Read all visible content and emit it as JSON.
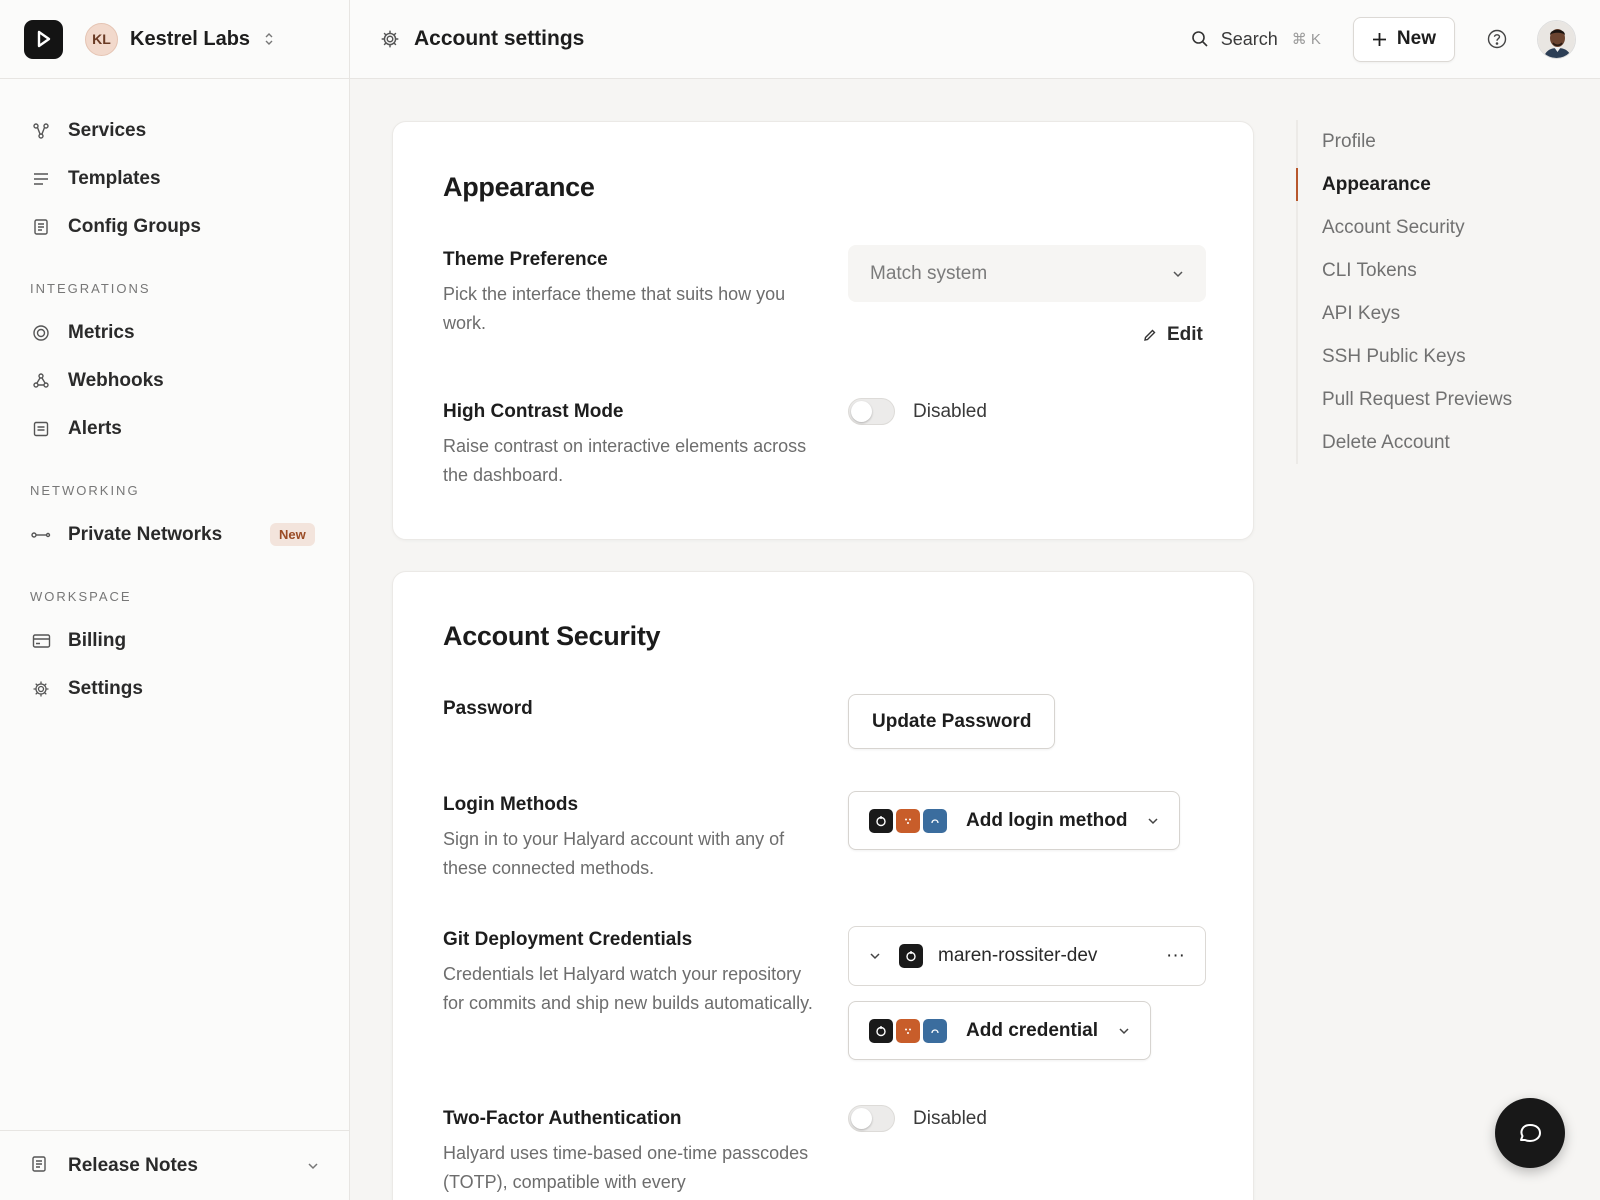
{
  "team": {
    "initials": "KL",
    "name": "Kestrel Labs"
  },
  "header": {
    "title": "Account settings",
    "search_label": "Search",
    "search_shortcut": "⌘ K",
    "new_label": "New"
  },
  "sidebar": {
    "main": [
      {
        "label": "Services",
        "icon": "services-icon"
      },
      {
        "label": "Templates",
        "icon": "templates-icon"
      },
      {
        "label": "Config Groups",
        "icon": "config-groups-icon"
      }
    ],
    "integrations_title": "INTEGRATIONS",
    "integrations": [
      {
        "label": "Metrics",
        "icon": "metrics-icon"
      },
      {
        "label": "Webhooks",
        "icon": "webhooks-icon"
      },
      {
        "label": "Alerts",
        "icon": "alerts-icon"
      }
    ],
    "networking_title": "NETWORKING",
    "networking": [
      {
        "label": "Private Networks",
        "icon": "private-networks-icon",
        "badge": "New"
      }
    ],
    "workspace_title": "WORKSPACE",
    "workspace": [
      {
        "label": "Billing",
        "icon": "billing-icon"
      },
      {
        "label": "Settings",
        "icon": "gear-icon"
      }
    ],
    "footer_label": "Release Notes"
  },
  "appearance": {
    "title": "Appearance",
    "theme": {
      "title": "Theme Preference",
      "desc": "Pick the interface theme that suits how you work.",
      "value": "Match system",
      "edit_label": "Edit"
    },
    "contrast": {
      "title": "High Contrast Mode",
      "desc": "Raise contrast on interactive elements across the dashboard.",
      "state": "Disabled"
    }
  },
  "security": {
    "title": "Account Security",
    "password": {
      "title": "Password",
      "button": "Update Password"
    },
    "login": {
      "title": "Login Methods",
      "desc": "Sign in to your Halyard account with any of these connected methods.",
      "button": "Add login method"
    },
    "git": {
      "title": "Git Deployment Credentials",
      "desc": "Credentials let Halyard watch your repository for commits and ship new builds automatically.",
      "credential_name": "maren-rossiter-dev",
      "more_label": "···",
      "add_button": "Add credential"
    },
    "twofa": {
      "title": "Two-Factor Authentication",
      "desc": "Halyard uses time-based one-time passcodes (TOTP), compatible with every",
      "state": "Disabled"
    }
  },
  "toc": [
    "Profile",
    "Appearance",
    "Account Security",
    "CLI Tokens",
    "API Keys",
    "SSH Public Keys",
    "Pull Request Previews",
    "Delete Account"
  ],
  "colors": {
    "accent": "#b8572c",
    "gitlab": "#c85d2a",
    "bitbucket": "#3b6d9e",
    "github": "#1a1a1a"
  }
}
